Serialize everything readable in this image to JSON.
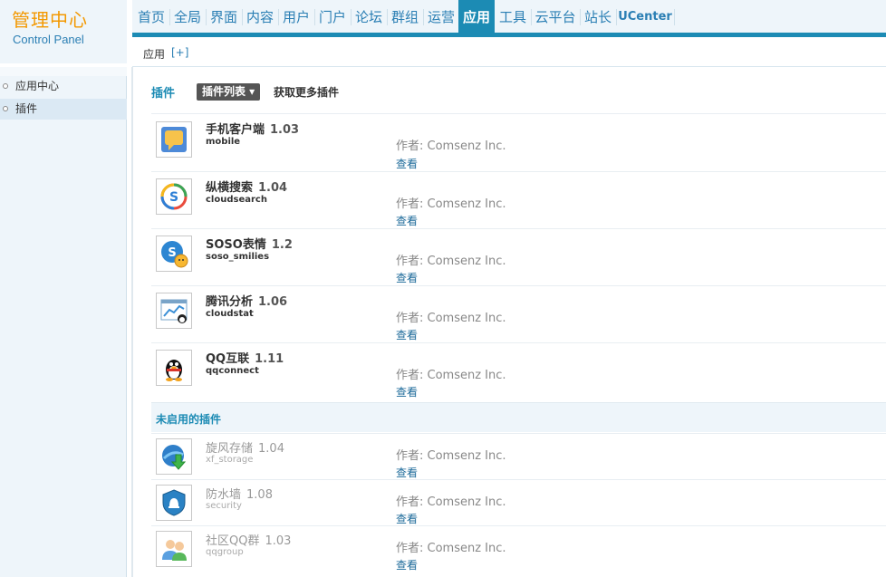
{
  "logo": {
    "cn": "管理中心",
    "en": "Control Panel"
  },
  "topnav": {
    "items": [
      "首页",
      "全局",
      "界面",
      "内容",
      "用户",
      "门户",
      "论坛",
      "群组",
      "运营",
      "应用",
      "工具",
      "云平台",
      "站长",
      "UCenter"
    ],
    "active": "应用"
  },
  "subbar": {
    "label": "应用",
    "plus": "[+]"
  },
  "sidebar": {
    "items": [
      "应用中心",
      "插件"
    ],
    "active": "插件"
  },
  "main": {
    "title": "插件",
    "dropdown": "插件列表 ▾",
    "more": "获取更多插件",
    "enabled": [
      {
        "name": "手机客户端",
        "version": "1.03",
        "id": "mobile",
        "author": "作者: Comsenz Inc.",
        "view": "查看",
        "icon": "mobile-client-icon"
      },
      {
        "name": "纵横搜索",
        "version": "1.04",
        "id": "cloudsearch",
        "author": "作者: Comsenz Inc.",
        "view": "查看",
        "icon": "cloudsearch-icon"
      },
      {
        "name": "SOSO表情",
        "version": "1.2",
        "id": "soso_smilies",
        "author": "作者: Comsenz Inc.",
        "view": "查看",
        "icon": "soso-smilies-icon"
      },
      {
        "name": "腾讯分析",
        "version": "1.06",
        "id": "cloudstat",
        "author": "作者: Comsenz Inc.",
        "view": "查看",
        "icon": "cloudstat-icon"
      },
      {
        "name": "QQ互联",
        "version": "1.11",
        "id": "qqconnect",
        "author": "作者: Comsenz Inc.",
        "view": "查看",
        "icon": "qq-penguin-icon"
      }
    ],
    "disabled_title": "未启用的插件",
    "disabled": [
      {
        "name": "旋风存储",
        "version": "1.04",
        "id": "xf_storage",
        "author": "作者: Comsenz Inc.",
        "view": "查看",
        "icon": "xf-storage-icon"
      },
      {
        "name": "防水墙",
        "version": "1.08",
        "id": "security",
        "author": "作者: Comsenz Inc.",
        "view": "查看",
        "icon": "security-shield-icon"
      },
      {
        "name": "社区QQ群",
        "version": "1.03",
        "id": "qqgroup",
        "author": "作者: Comsenz Inc.",
        "view": "查看",
        "icon": "qqgroup-icon"
      }
    ]
  },
  "colors": {
    "accent": "#1c8bb4",
    "logo": "#f39800",
    "link": "#2b7fb4"
  }
}
